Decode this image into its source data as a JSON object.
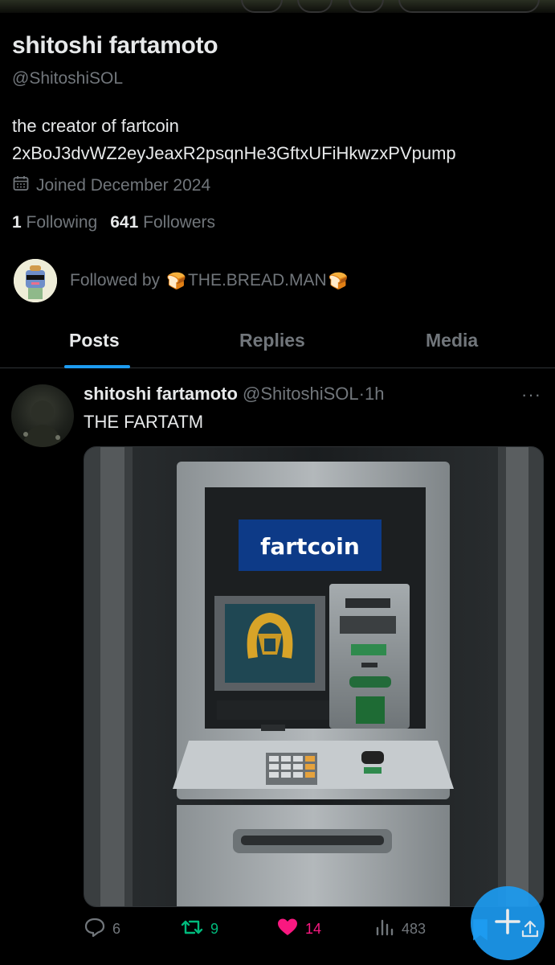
{
  "profile": {
    "name": "shitoshi fartamoto",
    "handle": "@ShitoshiSOL",
    "bio_line1": "the creator of fartcoin",
    "bio_line2": "2xBoJ3dvWZ2eyJeaxR2psqnHe3GftxUFiHkwzxPVpump",
    "joined": "Joined December 2024",
    "following_count": "1",
    "following_label": "Following",
    "followers_count": "641",
    "followers_label": "Followers",
    "followed_by_prefix": "Followed by",
    "followed_by_name": "THE.BREAD.MAN"
  },
  "tabs": [
    {
      "label": "Posts",
      "active": true
    },
    {
      "label": "Replies",
      "active": false
    },
    {
      "label": "Media",
      "active": false
    }
  ],
  "post": {
    "author": "shitoshi fartamoto",
    "handle": "@ShitoshiSOL",
    "separator": "·",
    "time": "1h",
    "more": "···",
    "text": "THE FARTATM",
    "image_sign_text": "fartcoin",
    "actions": {
      "replies": "6",
      "reposts": "9",
      "likes": "14",
      "views": "483"
    }
  },
  "colors": {
    "accent": "#1d9bf0",
    "repost": "#00ba7c",
    "like": "#f91880",
    "muted": "#71767b",
    "text": "#e7e9ea"
  },
  "icons": [
    "calendar-icon",
    "bread-icon",
    "more-icon",
    "reply-icon",
    "repost-icon",
    "heart-icon",
    "views-icon",
    "bookmark-icon",
    "compose-plus-icon",
    "share-icon"
  ]
}
